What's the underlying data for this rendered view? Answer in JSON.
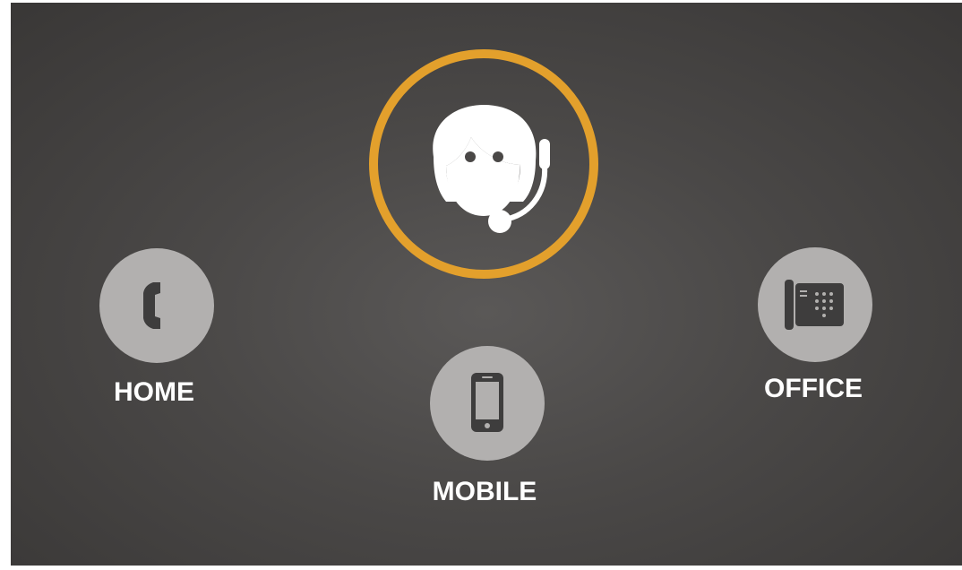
{
  "agent": {
    "icon": "customer-support-headset-icon",
    "ring_color": "#e3a02c"
  },
  "channels": [
    {
      "label": "HOME",
      "icon": "phone-handset-icon"
    },
    {
      "label": "MOBILE",
      "icon": "mobile-phone-icon"
    },
    {
      "label": "OFFICE",
      "icon": "office-desk-phone-icon"
    }
  ],
  "colors": {
    "background": "#4a4847",
    "circle": "#b2b0af",
    "icon": "#3e3d3d",
    "text": "#ffffff"
  }
}
